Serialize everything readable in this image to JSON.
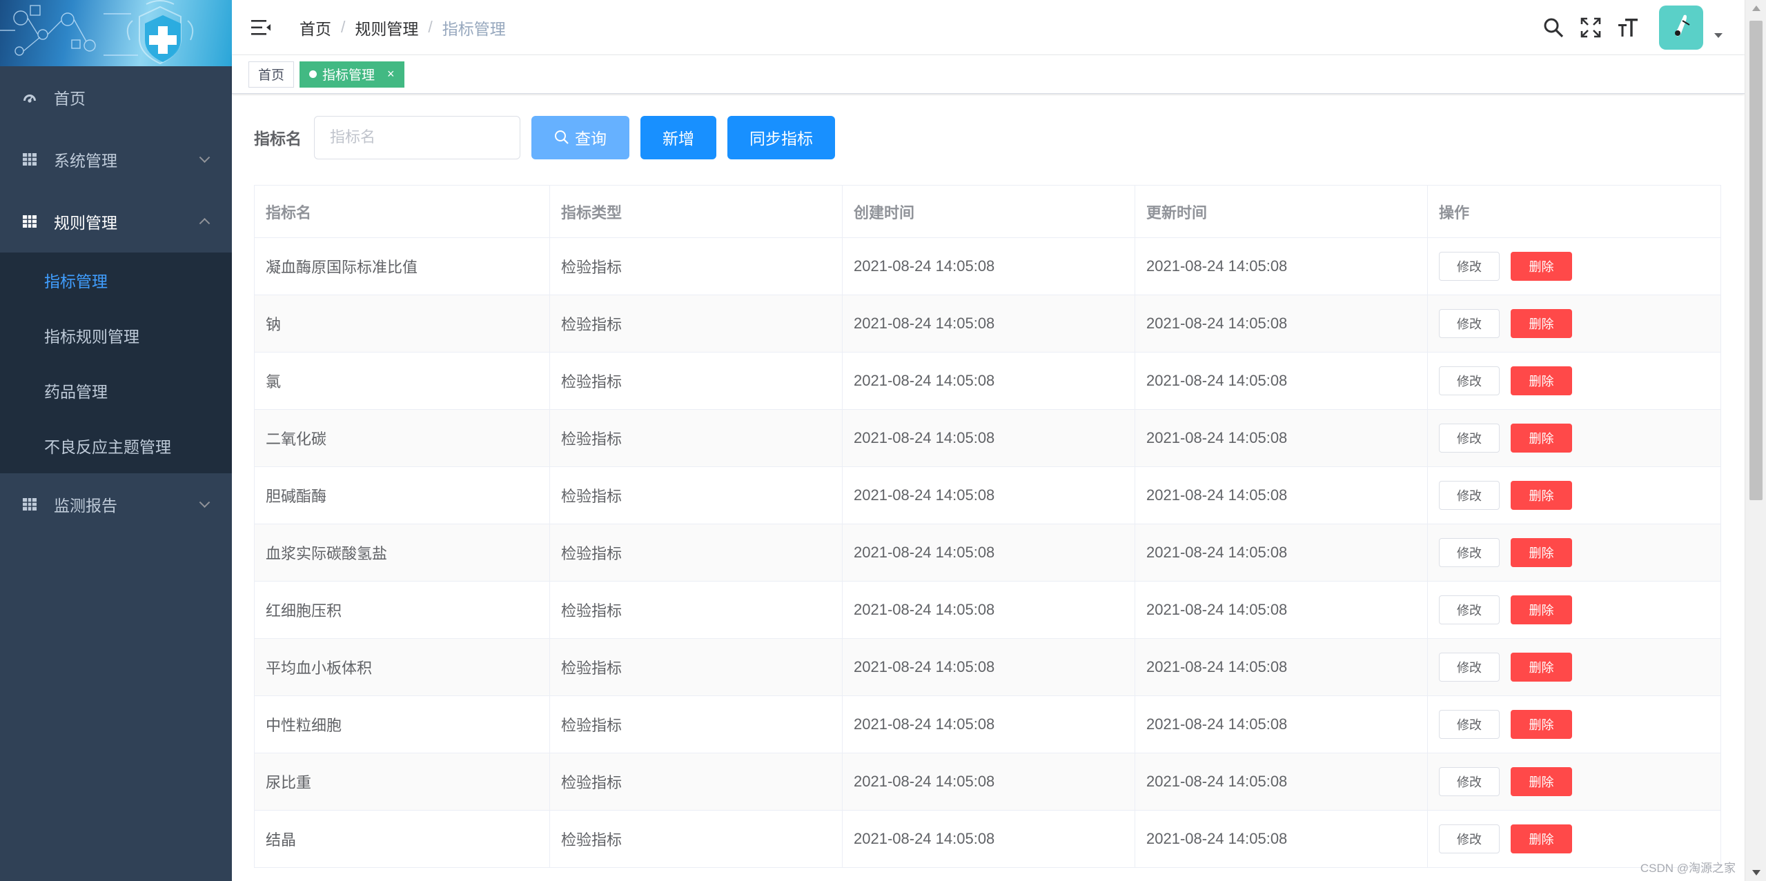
{
  "sidebar": {
    "items": [
      {
        "label": "首页",
        "icon": "dashboard-icon"
      },
      {
        "label": "系统管理",
        "icon": "grid-icon",
        "expanded": false
      },
      {
        "label": "规则管理",
        "icon": "grid-icon",
        "expanded": true,
        "children": [
          {
            "label": "指标管理",
            "active": true
          },
          {
            "label": "指标规则管理"
          },
          {
            "label": "药品管理"
          },
          {
            "label": "不良反应主题管理"
          }
        ]
      },
      {
        "label": "监测报告",
        "icon": "grid-icon",
        "expanded": false
      }
    ]
  },
  "header": {
    "breadcrumb": [
      "首页",
      "规则管理",
      "指标管理"
    ],
    "separator": "/"
  },
  "tags": [
    {
      "label": "首页",
      "active": false
    },
    {
      "label": "指标管理",
      "active": true,
      "close": "×"
    }
  ],
  "search": {
    "label": "指标名",
    "placeholder": "指标名",
    "value": "",
    "query_label": "查询",
    "add_label": "新增",
    "sync_label": "同步指标"
  },
  "table": {
    "columns": [
      "指标名",
      "指标类型",
      "创建时间",
      "更新时间",
      "操作"
    ],
    "edit_label": "修改",
    "delete_label": "删除",
    "rows": [
      {
        "name": "凝血酶原国际标准比值",
        "type": "检验指标",
        "created": "2021-08-24 14:05:08",
        "updated": "2021-08-24 14:05:08"
      },
      {
        "name": "钠",
        "type": "检验指标",
        "created": "2021-08-24 14:05:08",
        "updated": "2021-08-24 14:05:08"
      },
      {
        "name": "氯",
        "type": "检验指标",
        "created": "2021-08-24 14:05:08",
        "updated": "2021-08-24 14:05:08"
      },
      {
        "name": "二氧化碳",
        "type": "检验指标",
        "created": "2021-08-24 14:05:08",
        "updated": "2021-08-24 14:05:08"
      },
      {
        "name": "胆碱酯酶",
        "type": "检验指标",
        "created": "2021-08-24 14:05:08",
        "updated": "2021-08-24 14:05:08"
      },
      {
        "name": "血浆实际碳酸氢盐",
        "type": "检验指标",
        "created": "2021-08-24 14:05:08",
        "updated": "2021-08-24 14:05:08"
      },
      {
        "name": "红细胞压积",
        "type": "检验指标",
        "created": "2021-08-24 14:05:08",
        "updated": "2021-08-24 14:05:08"
      },
      {
        "name": "平均血小板体积",
        "type": "检验指标",
        "created": "2021-08-24 14:05:08",
        "updated": "2021-08-24 14:05:08"
      },
      {
        "name": "中性粒细胞",
        "type": "检验指标",
        "created": "2021-08-24 14:05:08",
        "updated": "2021-08-24 14:05:08"
      },
      {
        "name": "尿比重",
        "type": "检验指标",
        "created": "2021-08-24 14:05:08",
        "updated": "2021-08-24 14:05:08"
      },
      {
        "name": "结晶",
        "type": "检验指标",
        "created": "2021-08-24 14:05:08",
        "updated": "2021-08-24 14:05:08"
      }
    ]
  },
  "watermark": "CSDN @淘源之家",
  "colors": {
    "sidebar_bg": "#304156",
    "submenu_bg": "#1f2d3d",
    "active_menu": "#409eff",
    "tag_active": "#42b983",
    "primary": "#1890ff",
    "danger": "#ff4949"
  }
}
